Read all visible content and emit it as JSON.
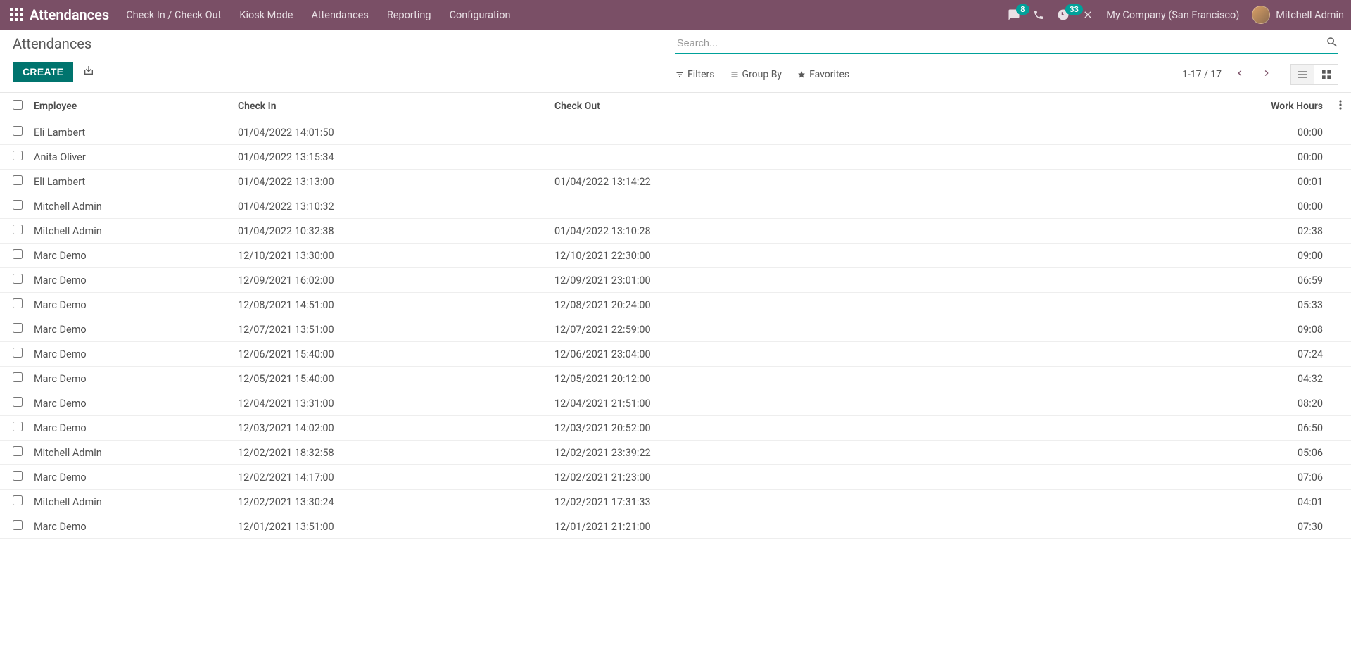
{
  "topbar": {
    "brand": "Attendances",
    "menu": [
      "Check In / Check Out",
      "Kiosk Mode",
      "Attendances",
      "Reporting",
      "Configuration"
    ],
    "msg_badge": "8",
    "clock_badge": "33",
    "company": "My Company (San Francisco)",
    "user": "Mitchell Admin"
  },
  "page": {
    "title": "Attendances",
    "create_label": "CREATE"
  },
  "search": {
    "placeholder": "Search..."
  },
  "controls": {
    "filters": "Filters",
    "groupby": "Group By",
    "favorites": "Favorites",
    "pager": "1-17 / 17"
  },
  "columns": {
    "employee": "Employee",
    "check_in": "Check In",
    "check_out": "Check Out",
    "work_hours": "Work Hours"
  },
  "rows": [
    {
      "employee": "Eli Lambert",
      "check_in": "01/04/2022 14:01:50",
      "check_out": "",
      "work_hours": "00:00"
    },
    {
      "employee": "Anita Oliver",
      "check_in": "01/04/2022 13:15:34",
      "check_out": "",
      "work_hours": "00:00"
    },
    {
      "employee": "Eli Lambert",
      "check_in": "01/04/2022 13:13:00",
      "check_out": "01/04/2022 13:14:22",
      "work_hours": "00:01"
    },
    {
      "employee": "Mitchell Admin",
      "check_in": "01/04/2022 13:10:32",
      "check_out": "",
      "work_hours": "00:00"
    },
    {
      "employee": "Mitchell Admin",
      "check_in": "01/04/2022 10:32:38",
      "check_out": "01/04/2022 13:10:28",
      "work_hours": "02:38"
    },
    {
      "employee": "Marc Demo",
      "check_in": "12/10/2021 13:30:00",
      "check_out": "12/10/2021 22:30:00",
      "work_hours": "09:00"
    },
    {
      "employee": "Marc Demo",
      "check_in": "12/09/2021 16:02:00",
      "check_out": "12/09/2021 23:01:00",
      "work_hours": "06:59"
    },
    {
      "employee": "Marc Demo",
      "check_in": "12/08/2021 14:51:00",
      "check_out": "12/08/2021 20:24:00",
      "work_hours": "05:33"
    },
    {
      "employee": "Marc Demo",
      "check_in": "12/07/2021 13:51:00",
      "check_out": "12/07/2021 22:59:00",
      "work_hours": "09:08"
    },
    {
      "employee": "Marc Demo",
      "check_in": "12/06/2021 15:40:00",
      "check_out": "12/06/2021 23:04:00",
      "work_hours": "07:24"
    },
    {
      "employee": "Marc Demo",
      "check_in": "12/05/2021 15:40:00",
      "check_out": "12/05/2021 20:12:00",
      "work_hours": "04:32"
    },
    {
      "employee": "Marc Demo",
      "check_in": "12/04/2021 13:31:00",
      "check_out": "12/04/2021 21:51:00",
      "work_hours": "08:20"
    },
    {
      "employee": "Marc Demo",
      "check_in": "12/03/2021 14:02:00",
      "check_out": "12/03/2021 20:52:00",
      "work_hours": "06:50"
    },
    {
      "employee": "Mitchell Admin",
      "check_in": "12/02/2021 18:32:58",
      "check_out": "12/02/2021 23:39:22",
      "work_hours": "05:06"
    },
    {
      "employee": "Marc Demo",
      "check_in": "12/02/2021 14:17:00",
      "check_out": "12/02/2021 21:23:00",
      "work_hours": "07:06"
    },
    {
      "employee": "Mitchell Admin",
      "check_in": "12/02/2021 13:30:24",
      "check_out": "12/02/2021 17:31:33",
      "work_hours": "04:01"
    },
    {
      "employee": "Marc Demo",
      "check_in": "12/01/2021 13:51:00",
      "check_out": "12/01/2021 21:21:00",
      "work_hours": "07:30"
    }
  ]
}
